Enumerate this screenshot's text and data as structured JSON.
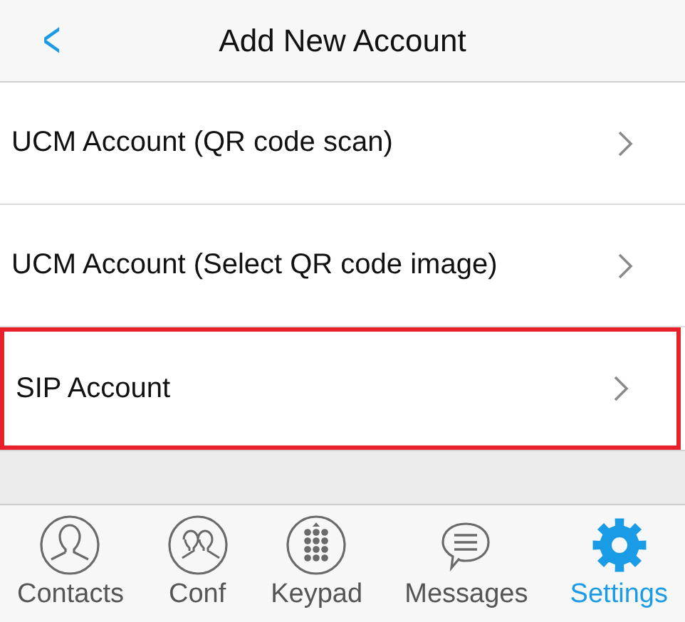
{
  "header": {
    "back_icon": "<",
    "title": "Add New Account"
  },
  "items": [
    {
      "label": "UCM Account (QR code scan)",
      "highlighted": false
    },
    {
      "label": "UCM Account (Select QR code image)",
      "highlighted": false
    },
    {
      "label": "SIP Account",
      "highlighted": true
    }
  ],
  "tabs": [
    {
      "label": "Contacts",
      "selected": false
    },
    {
      "label": "Conf",
      "selected": false
    },
    {
      "label": "Keypad",
      "selected": false
    },
    {
      "label": "Messages",
      "selected": false
    },
    {
      "label": "Settings",
      "selected": true
    }
  ]
}
